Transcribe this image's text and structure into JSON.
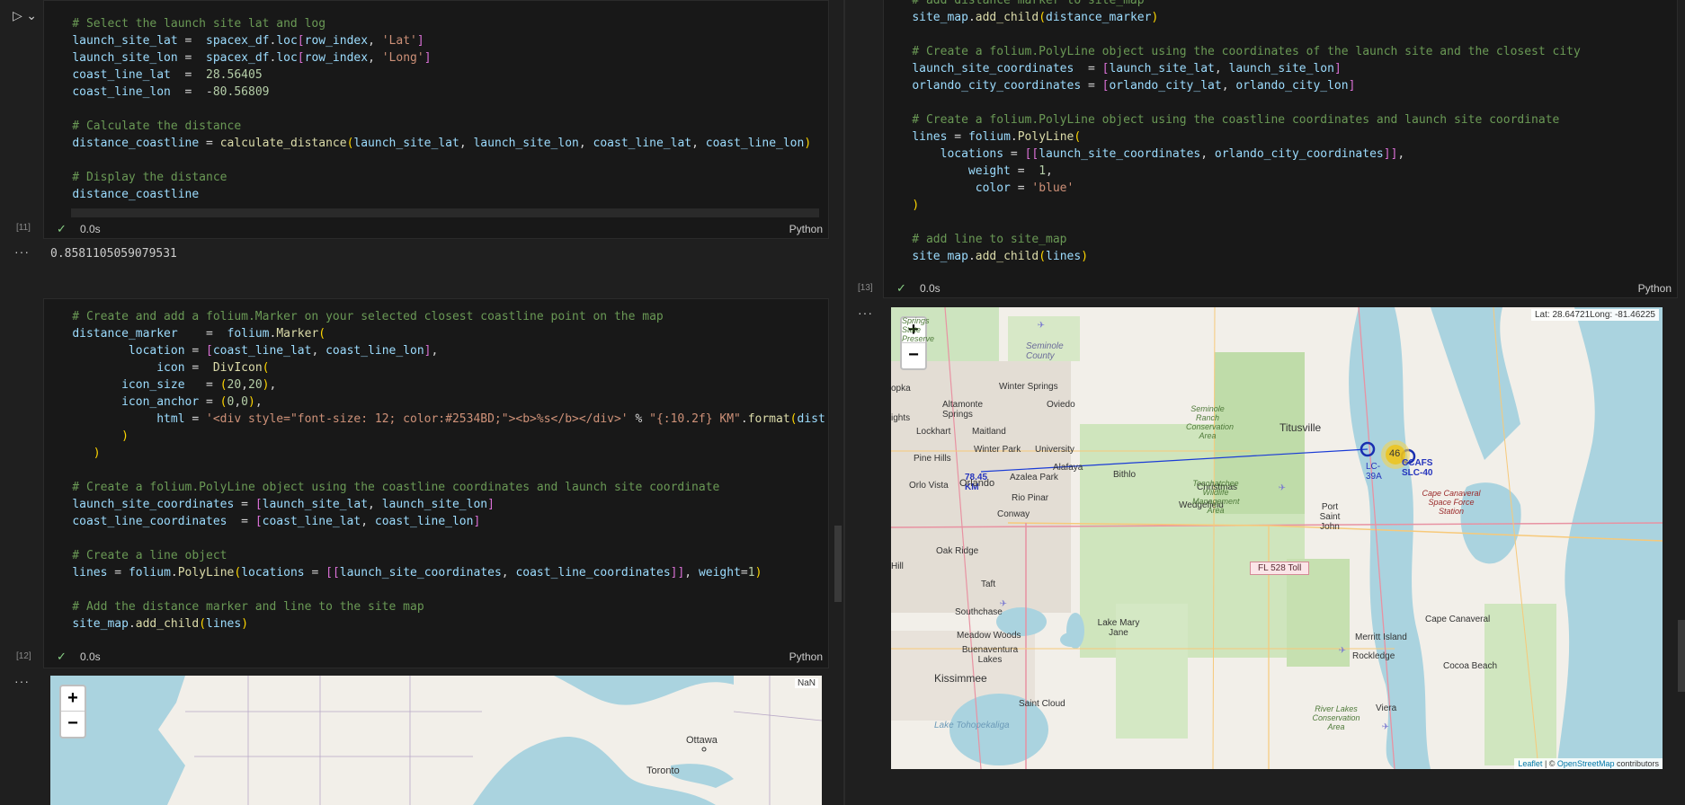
{
  "left_pane": {
    "cell11": {
      "exec_count": "[11]",
      "status_time": "0.0s",
      "language": "Python",
      "lines": [
        "    # Select the launch site lat and log",
        "    launch_site_lat =  spacex_df.loc[row_index, 'Lat']",
        "    launch_site_lon =  spacex_df.loc[row_index, 'Long']",
        "    coast_line_lat  =  28.56405",
        "    coast_line_lon  =  -80.56809",
        "",
        "    # Calculate the distance",
        "    distance_coastline = calculate_distance(launch_site_lat, launch_site_lon, coast_line_lat, coast_line_lon)",
        "",
        "    # Display the distance",
        "    distance_coastline"
      ],
      "output_value": "0.8581105059079531"
    },
    "cell12": {
      "exec_count": "[12]",
      "status_time": "0.0s",
      "language": "Python",
      "lines": [
        "    # Create and add a folium.Marker on your selected closest coastline point on the map",
        "    distance_marker    =  folium.Marker(",
        "            location = [coast_line_lat, coast_line_lon],",
        "                icon =  DivIcon(",
        "           icon_size   = (20,20),",
        "           icon_anchor = (0,0),",
        "                html = '<div style=\"font-size: 12; color:#2534BD;\"><b>%s</b></div>' % \"{:10.2f} KM\".format(dist",
        "           )",
        "       )",
        "",
        "    # Create a folium.PolyLine object using the coastline coordinates and launch site coordinate",
        "    launch_site_coordinates = [launch_site_lat, launch_site_lon]",
        "    coast_line_coordinates  = [coast_line_lat, coast_line_lon]",
        "",
        "    # Create a line object",
        "    lines = folium.PolyLine(locations = [[launch_site_coordinates, coast_line_coordinates]], weight=1)",
        "",
        "    # Add the distance marker and line to the site map",
        "    site_map.add_child(lines)"
      ]
    },
    "small_map": {
      "zoom_in": "+",
      "zoom_out": "−",
      "coord_readout": "NaN",
      "labels": [
        "Ottawa",
        "Toronto"
      ]
    }
  },
  "right_pane": {
    "cell13": {
      "exec_count": "[13]",
      "status_time": "0.0s",
      "language": "Python",
      "lines": [
        "    # add distance marker to site_map",
        "    site_map.add_child(distance_marker)",
        "",
        "    # Create a folium.PolyLine object using the coordinates of the launch site and the closest city",
        "    launch_site_coordinates  = [launch_site_lat, launch_site_lon]",
        "    orlando_city_coordinates = [orlando_city_lat, orlando_city_lon]",
        "",
        "    # Create a folium.PolyLine object using the coastline coordinates and launch site coordinate",
        "    lines = folium.PolyLine(",
        "        locations = [[launch_site_coordinates, orlando_city_coordinates]],",
        "            weight =  1,",
        "             color = 'blue'",
        "    )",
        "",
        "    # add line to site_map",
        "    site_map.add_child(lines)"
      ]
    },
    "big_map": {
      "zoom_in": "+",
      "zoom_out": "−",
      "coord_readout": "Lat: 28.64721Long: -81.46225",
      "cluster_count": "46",
      "distance_label": "78.45 KM",
      "road_label": "FL 528 Toll",
      "attribution_leaflet": "Leaflet",
      "attribution_sep": " | © ",
      "attribution_osm": "OpenStreetMap",
      "attribution_tail": " contributors",
      "place_labels": [
        "Winter Springs",
        "Altamonte Springs",
        "Oviedo",
        "Seminole County",
        "Lockhart",
        "Maitland",
        "Winter Park",
        "University",
        "Pine Hills",
        "Alafaya",
        "Orlo Vista",
        "Orlando",
        "Azalea Park",
        "Bithlo",
        "Christmas",
        "Rio Pinar",
        "Conway",
        "Wedgefield",
        "Oak Ridge",
        "Taft",
        "Southchase",
        "Meadow Woods",
        "Buenaventura Lakes",
        "Kissimmee",
        "Saint Cloud",
        "Lake Mary Jane",
        "Lake Tohopekaliga",
        "Titusville",
        "Port Saint John",
        "Seminole Ranch Conservation Area",
        "Tosohatchee Wildlife Management Area",
        "Merritt Island",
        "Rockledge",
        "Cocoa Beach",
        "Cape Canaveral",
        "Cape Canaveral Space Force Station",
        "Viera",
        "River Lakes Conservation Area",
        "CCAFS SLC-40",
        "LC-39A",
        "Springs State Preserve",
        "Hill",
        "ights",
        "opka"
      ]
    }
  }
}
